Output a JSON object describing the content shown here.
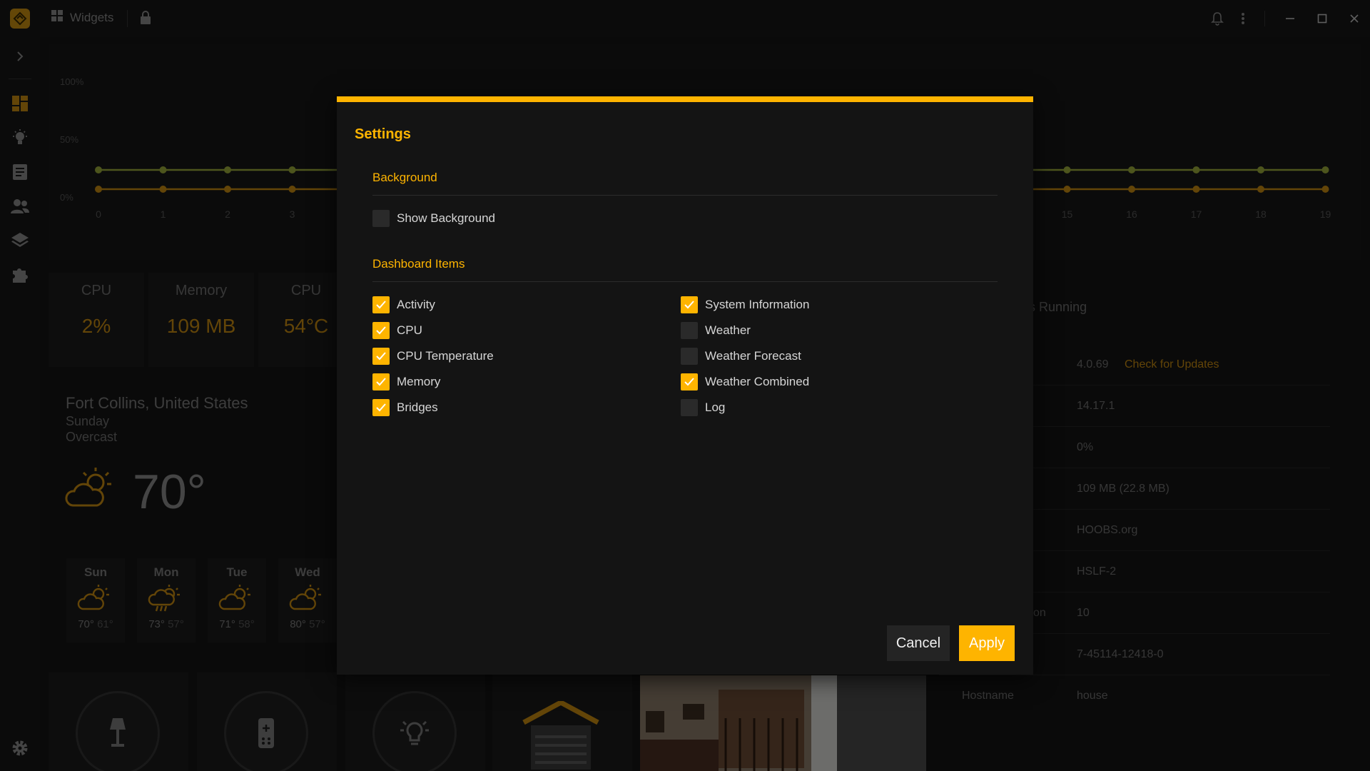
{
  "titlebar": {
    "title": "Widgets"
  },
  "chart": {
    "y_labels": [
      "100%",
      "50%",
      "0%"
    ],
    "x_labels": [
      "0",
      "1",
      "2",
      "3",
      "15",
      "16",
      "17",
      "18",
      "19"
    ]
  },
  "stats": [
    {
      "label": "CPU",
      "value": "2%"
    },
    {
      "label": "Memory",
      "value": "109 MB"
    },
    {
      "label": "CPU",
      "value": "54°C"
    }
  ],
  "weather": {
    "location": "Fort Collins, United States",
    "day": "Sunday",
    "condition": "Overcast",
    "temp": "70°",
    "forecast": [
      {
        "day": "Sun",
        "high": "70°",
        "low": "61°"
      },
      {
        "day": "Mon",
        "high": "73°",
        "low": "57°"
      },
      {
        "day": "Tue",
        "high": "71°",
        "low": "58°"
      },
      {
        "day": "Wed",
        "high": "80°",
        "low": "57°"
      }
    ]
  },
  "bridges": {
    "text": "dges Running"
  },
  "sysinfo": {
    "version": "4.0.69",
    "check_updates": "Check for Updates",
    "rows": [
      {
        "key": "",
        "value": "14.17.1"
      },
      {
        "key": "",
        "value": "0%"
      },
      {
        "key": "",
        "value": "109 MB (22.8 MB)"
      },
      {
        "key": "",
        "value": "HOOBS.org"
      },
      {
        "key": "",
        "value": "HSLF-2"
      },
      {
        "key": "on",
        "value": "10"
      },
      {
        "key": "",
        "value": "7-45114-12418-0"
      },
      {
        "key": "Hostname",
        "value": "house"
      }
    ]
  },
  "modal": {
    "title": "Settings",
    "background_section": "Background",
    "show_background": {
      "label": "Show Background",
      "checked": false
    },
    "items_section": "Dashboard Items",
    "items_left": [
      {
        "label": "Activity",
        "checked": true
      },
      {
        "label": "CPU",
        "checked": true
      },
      {
        "label": "CPU Temperature",
        "checked": true
      },
      {
        "label": "Memory",
        "checked": true
      },
      {
        "label": "Bridges",
        "checked": true
      }
    ],
    "items_right": [
      {
        "label": "System Information",
        "checked": true
      },
      {
        "label": "Weather",
        "checked": false
      },
      {
        "label": "Weather Forecast",
        "checked": false
      },
      {
        "label": "Weather Combined",
        "checked": true
      },
      {
        "label": "Log",
        "checked": false
      }
    ],
    "cancel_label": "Cancel",
    "apply_label": "Apply"
  },
  "colors": {
    "accent": "#feb400",
    "dim_accent": "#c68a10",
    "line_green": "#9aab3a"
  }
}
